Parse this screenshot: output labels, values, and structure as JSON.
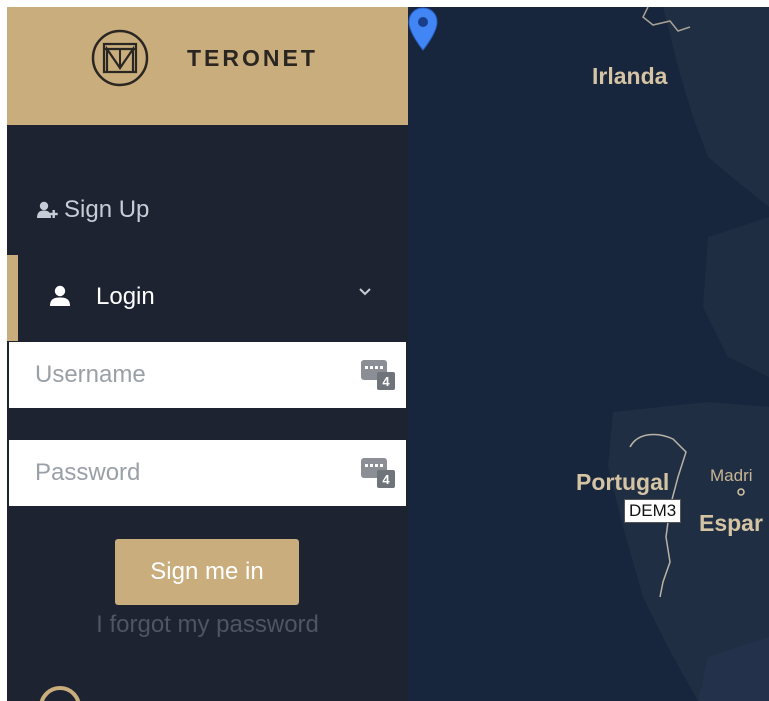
{
  "brand": {
    "name": "TERONET",
    "logo_icon": "tm-monogram-logo"
  },
  "nav": {
    "signup": {
      "label": "Sign Up",
      "icon": "user-plus-icon"
    },
    "login": {
      "label": "Login",
      "icon": "user-icon",
      "expanded": true
    }
  },
  "login_form": {
    "username_placeholder": "Username",
    "username_value": "",
    "password_placeholder": "Password",
    "password_value": "",
    "keyboard_icon_badge": "4",
    "submit_label": "Sign me in",
    "forgot_label": "I forgot my password"
  },
  "map": {
    "labels": {
      "irlanda": "Irlanda",
      "portugal": "Portugal",
      "espana": "Espar",
      "madrid": "Madri"
    },
    "marker": {
      "label": "DEM3",
      "color": "#4285f4"
    }
  },
  "colors": {
    "accent": "#c9ad7d",
    "sidebar_bg": "#1d2330",
    "map_water": "#17263c",
    "map_land": "#1f2e42"
  }
}
